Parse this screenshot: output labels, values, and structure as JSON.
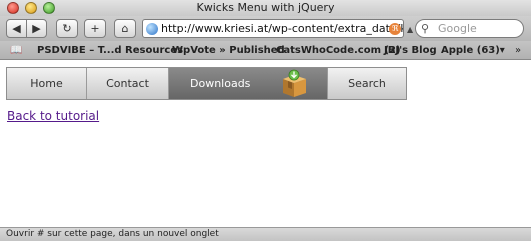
{
  "window": {
    "title": "Kwicks Menu with jQuery"
  },
  "toolbar": {
    "back_glyph": "◀",
    "forward_glyph": "▶",
    "reload_glyph": "↻",
    "add_glyph": "+",
    "home_glyph": "⌂",
    "url": "http://www.kriesi.at/wp-content/extra_data/kwic",
    "rss_glyph": "ℜ",
    "dropdown_glyph": "▲",
    "search_placeholder": "Google",
    "search_glyph": "⚲"
  },
  "bookmarks": {
    "book_glyph": "📖",
    "items": [
      "PSDVIBE – T...d Resources",
      "WpVote » Published",
      "CatsWhoCode.com (2)",
      "JBJ's Blog",
      "Apple (63)▾"
    ],
    "more_glyph": "»"
  },
  "menu": {
    "items": [
      "Home",
      "Contact",
      "Downloads",
      "Search"
    ],
    "active": "Downloads"
  },
  "content": {
    "back_link": "Back to tutorial"
  },
  "status": {
    "text": "Ouvrir # sur cette page, dans un nouvel onglet"
  },
  "colors": {
    "link": "#551a8b",
    "active_tab": "#777777",
    "rss": "#e7833a"
  }
}
